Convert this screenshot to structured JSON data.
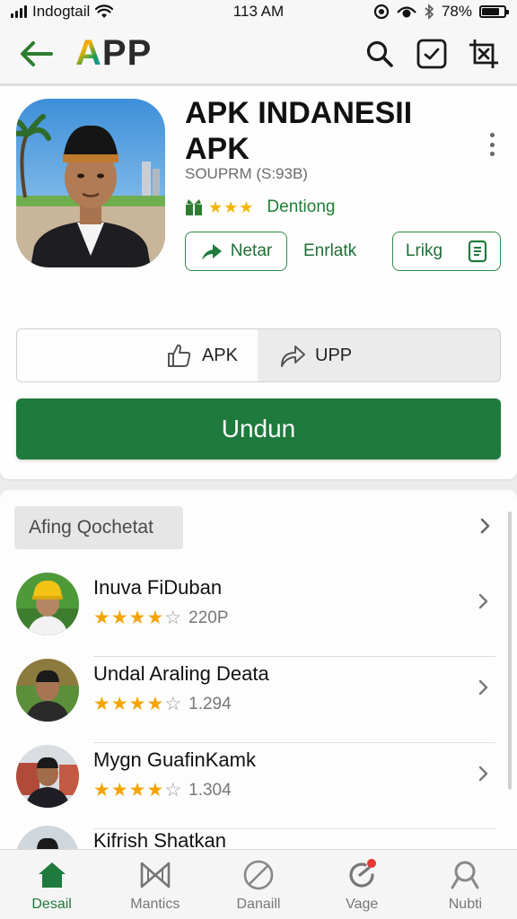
{
  "status_bar": {
    "carrier": "Indogtail",
    "time": "113 AM",
    "battery": "78%",
    "battery_level": 0.78
  },
  "app_bar": {
    "logo_a": "A",
    "logo_rest": "PP",
    "icons": [
      "back-arrow-icon",
      "search-icon",
      "checkbox-icon",
      "crop-icon"
    ]
  },
  "app": {
    "title": "APK INDANESII APK",
    "subtitle": "SOUPRM (S:93B)",
    "rating_label": "Dentiong",
    "stars": 3,
    "actions": {
      "share_label": "Netar",
      "middle_label": "Enrlatk",
      "link_label": "Lrikg"
    },
    "segments": {
      "left_label": "APK",
      "right_label": "UPP"
    },
    "download_label": "Undun"
  },
  "section": {
    "title": "Afing Qochetat"
  },
  "list": [
    {
      "name": "Inuva FiDuban",
      "stars": 4,
      "count": "220P"
    },
    {
      "name": "Undal Araling Deata",
      "stars": 4,
      "count": "1.294"
    },
    {
      "name": "Mygn GuafinKamk",
      "stars": 4,
      "count": "1.304"
    },
    {
      "name": "Kifrish Shatkan"
    }
  ],
  "bottom_nav": [
    {
      "label": "Desail",
      "icon": "home-icon",
      "active": true
    },
    {
      "label": "Mantics",
      "icon": "bowtie-icon",
      "active": false
    },
    {
      "label": "Danaill",
      "icon": "block-icon",
      "active": false
    },
    {
      "label": "Vage",
      "icon": "refresh-icon",
      "active": false
    },
    {
      "label": "Nubti",
      "icon": "search-icon",
      "active": false
    }
  ],
  "colors": {
    "primary_green": "#1f7a3d",
    "star_gold": "#f4b400",
    "accent_red": "#e53935"
  }
}
